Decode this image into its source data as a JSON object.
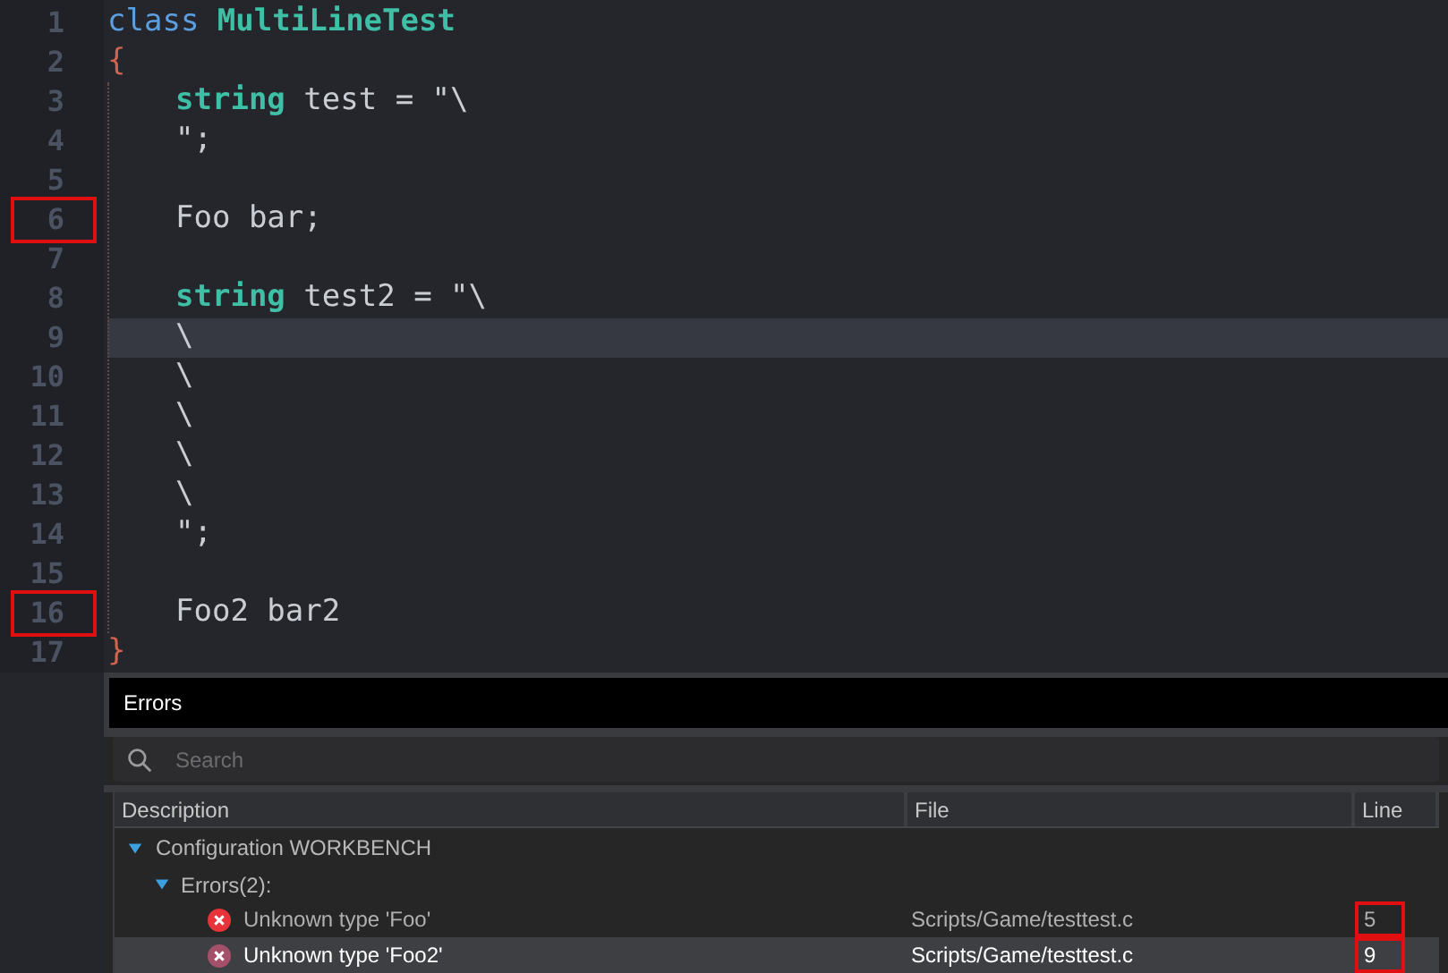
{
  "editor": {
    "lines": [
      {
        "number": "1",
        "marked": false,
        "current": false,
        "tokens": [
          {
            "text": "class ",
            "kind": "keyword"
          },
          {
            "text": "MultiLineTest",
            "kind": "type"
          }
        ]
      },
      {
        "number": "2",
        "marked": false,
        "current": false,
        "tokens": [
          {
            "text": "{",
            "kind": "brace"
          }
        ],
        "children": [
          {
            "number": "3",
            "marked": false,
            "current": false,
            "tokens": [
              {
                "text": "string",
                "kind": "type"
              },
              {
                "text": " test = \"\\",
                "kind": "plain"
              }
            ]
          },
          {
            "number": "4",
            "marked": false,
            "current": false,
            "tokens": [
              {
                "text": "\";",
                "kind": "plain"
              }
            ]
          },
          {
            "number": "5",
            "marked": false,
            "current": false
          },
          {
            "number": "6",
            "marked": true,
            "current": false,
            "tokens": [
              {
                "text": "Foo bar;",
                "kind": "plain"
              }
            ]
          },
          {
            "number": "7",
            "marked": false,
            "current": false
          },
          {
            "number": "8",
            "marked": false,
            "current": false,
            "tokens": [
              {
                "text": "string",
                "kind": "type"
              },
              {
                "text": " test2 = \"\\",
                "kind": "plain"
              }
            ]
          },
          {
            "number": "9",
            "marked": false,
            "current": true,
            "tokens": [
              {
                "text": "\\",
                "kind": "plain"
              }
            ]
          },
          {
            "number": "10",
            "marked": false,
            "current": false,
            "tokens": [
              {
                "text": "\\",
                "kind": "plain"
              }
            ]
          },
          {
            "number": "11",
            "marked": false,
            "current": false,
            "tokens": [
              {
                "text": "\\",
                "kind": "plain"
              }
            ]
          },
          {
            "number": "12",
            "marked": false,
            "current": false,
            "tokens": [
              {
                "text": "\\",
                "kind": "plain"
              }
            ]
          },
          {
            "number": "13",
            "marked": false,
            "current": false,
            "tokens": [
              {
                "text": "\\",
                "kind": "plain"
              }
            ]
          },
          {
            "number": "14",
            "marked": false,
            "current": false,
            "tokens": [
              {
                "text": "\";",
                "kind": "plain"
              }
            ]
          },
          {
            "number": "15",
            "marked": false,
            "current": false
          },
          {
            "number": "16",
            "marked": true,
            "current": false,
            "tokens": [
              {
                "text": "Foo2 bar2",
                "kind": "plain"
              }
            ]
          }
        ]
      },
      {
        "number": "17",
        "marked": false,
        "current": false,
        "tokens": [
          {
            "text": "}",
            "kind": "brace"
          }
        ]
      }
    ]
  },
  "errors_panel": {
    "title": "Errors",
    "search": {
      "placeholder": "Search"
    },
    "table": {
      "columns": [
        "Description",
        "File",
        "Line"
      ],
      "groups": [
        {
          "label": "Configuration WORKBENCH",
          "expanded": true,
          "children": [
            {
              "label": "Errors(2):",
              "expanded": true,
              "rows": [
                {
                  "description": "Unknown type 'Foo'",
                  "file": "Scripts/Game/testtest.c",
                  "line": "5",
                  "selected": false,
                  "marked": true
                },
                {
                  "description": "Unknown type 'Foo2'",
                  "file": "Scripts/Game/testtest.c",
                  "line": "9",
                  "selected": true,
                  "marked": true
                }
              ]
            }
          ]
        }
      ]
    }
  }
}
